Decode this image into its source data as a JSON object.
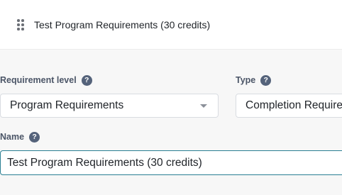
{
  "header": {
    "title": "Test Program Requirements (30 credits)"
  },
  "requirement_level": {
    "label": "Requirement level",
    "help": "?",
    "selected": "Program Requirements"
  },
  "type": {
    "label": "Type",
    "help": "?",
    "selected": "Completion Requirements"
  },
  "name": {
    "label": "Name",
    "help": "?",
    "value": "Test Program Requirements (30 credits)"
  },
  "colors": {
    "help_icon": "#54627a",
    "input_focus_border": "#2a7f93"
  }
}
